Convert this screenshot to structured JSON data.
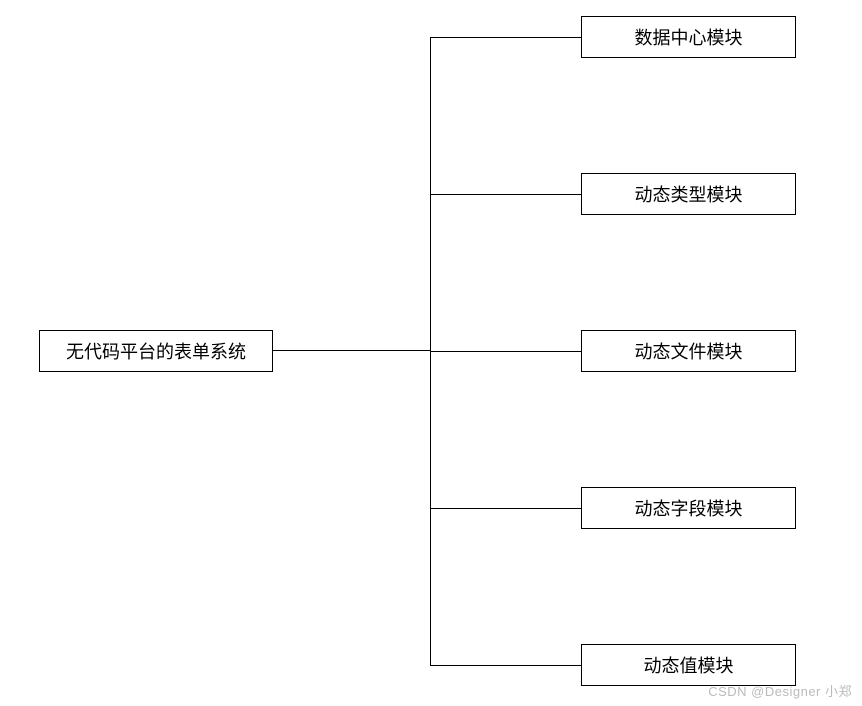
{
  "diagram": {
    "root": {
      "label": "无代码平台的表单系统"
    },
    "children": [
      {
        "label": "数据中心模块"
      },
      {
        "label": "动态类型模块"
      },
      {
        "label": "动态文件模块"
      },
      {
        "label": "动态字段模块"
      },
      {
        "label": "动态值模块"
      }
    ]
  },
  "watermark": "CSDN @Designer 小郑"
}
